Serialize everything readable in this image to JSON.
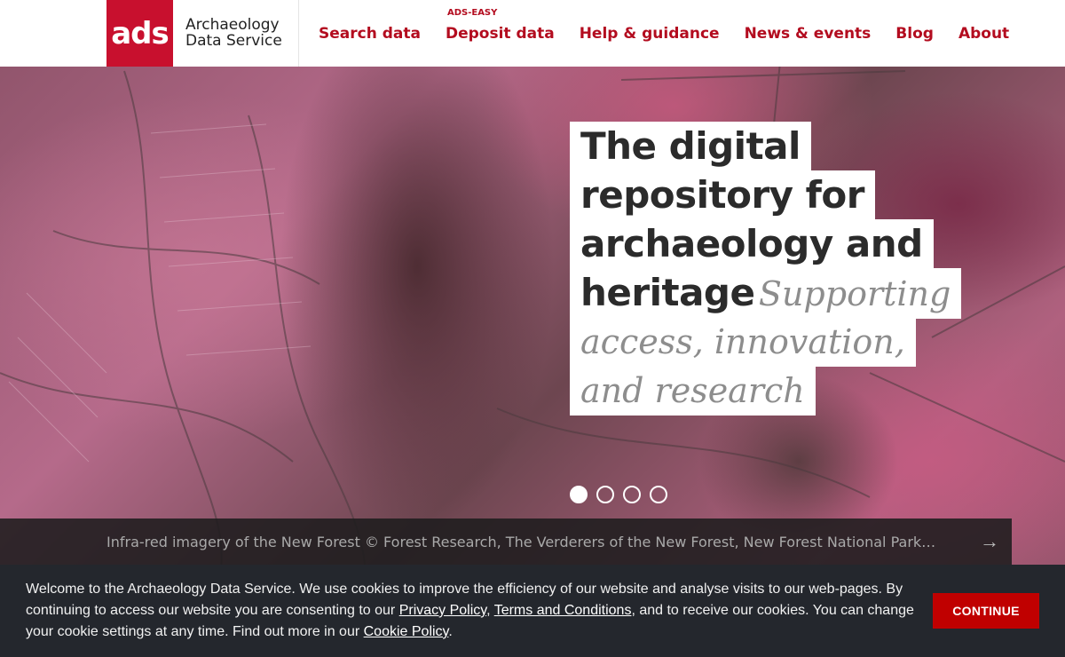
{
  "header": {
    "logo_mark": "ads",
    "logo_line1": "Archaeology",
    "logo_line2": "Data Service",
    "nav": [
      {
        "label": "Search data",
        "sup": ""
      },
      {
        "label": "Deposit data",
        "sup": "ADS-EASY"
      },
      {
        "label": "Help & guidance",
        "sup": ""
      },
      {
        "label": "News & events",
        "sup": ""
      },
      {
        "label": "Blog",
        "sup": ""
      },
      {
        "label": "About",
        "sup": ""
      }
    ]
  },
  "hero": {
    "headline_lines": [
      "The digital",
      "repository for",
      "archaeology and",
      "heritage"
    ],
    "tagline_inline": "Supporting",
    "tagline_lines": [
      "access, innovation,",
      "and research"
    ],
    "dots_count": 4,
    "active_dot": 1
  },
  "caption": {
    "text": "Infra-red imagery of the New Forest © Forest Research, The Verderers of the New Forest, New Forest National Park…",
    "arrow": "→"
  },
  "cookie": {
    "text_1": "Welcome to the Archaeology Data Service. We use cookies to improve the efficiency of our website and analyse visits to our web-pages. By continuing to access our website you are consenting to our ",
    "link_privacy": "Privacy Policy",
    "sep_1": ", ",
    "link_terms": "Terms and Conditions",
    "text_2": ", and to receive our cookies. You can change your cookie settings at any time. Find out more in our ",
    "link_cookie": "Cookie Policy",
    "text_3": ".",
    "button": "CONTINUE"
  }
}
